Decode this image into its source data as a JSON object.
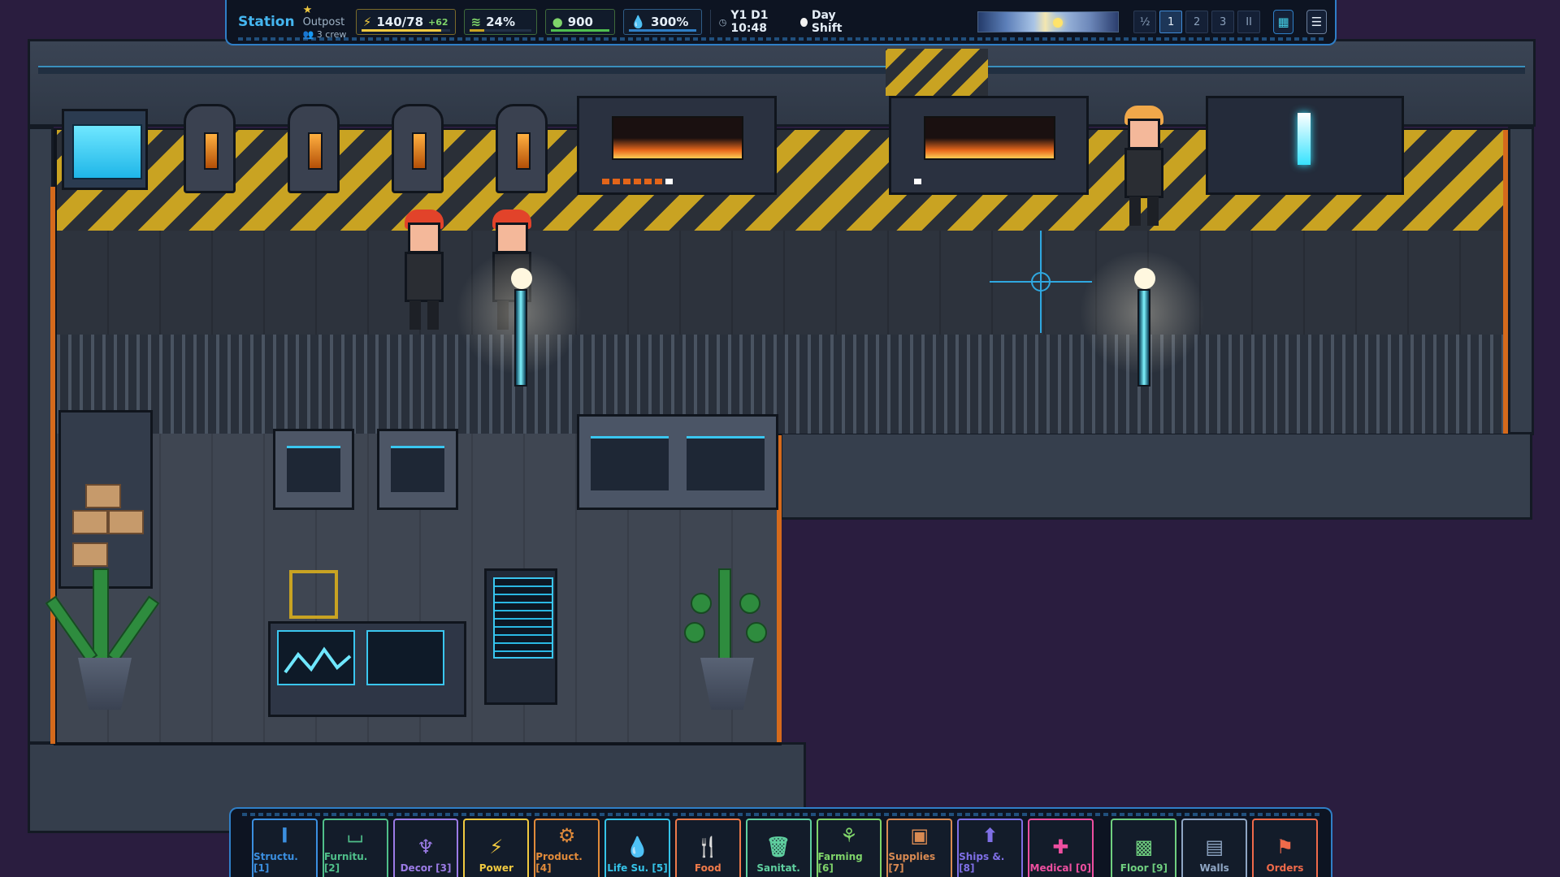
{
  "hud": {
    "title": "Station",
    "tier": "Outpost",
    "crew": "3 crew",
    "power_value": "140/78",
    "power_delta": "+62",
    "air_value": "24%",
    "food_value": "900",
    "water_value": "300%",
    "clock": "Y1 D1 10:48",
    "shift": "Day Shift",
    "speeds": [
      "½",
      "1",
      "2",
      "3",
      "II"
    ],
    "active_speed": "1"
  },
  "resource_levels": {
    "power": 0.9,
    "air": 0.24,
    "food": 1.0,
    "water": 1.0
  },
  "toolbar": {
    "tabs": [
      {
        "label": "Structu. [1]",
        "icon": "structure-icon",
        "color": "#3b8fe0"
      },
      {
        "label": "Furnitu. [2]",
        "icon": "furniture-icon",
        "color": "#4fbf8a"
      },
      {
        "label": "Decor [3]",
        "icon": "decor-icon",
        "color": "#9b7be6"
      },
      {
        "label": "Power",
        "icon": "lightning-icon",
        "color": "#f0c940"
      },
      {
        "label": "Product. [4]",
        "icon": "gear-icon",
        "color": "#e08a3a"
      },
      {
        "label": "Life Su. [5]",
        "icon": "droplet-icon",
        "color": "#35c3e8"
      },
      {
        "label": "Food",
        "icon": "utensils-icon",
        "color": "#ef7a4a"
      },
      {
        "label": "Sanitat.",
        "icon": "trash-icon",
        "color": "#5fcf9f"
      },
      {
        "label": "Farming [6]",
        "icon": "sprout-icon",
        "color": "#7fd46a"
      },
      {
        "label": "Supplies [7]",
        "icon": "crate-icon",
        "color": "#d98a52"
      },
      {
        "label": "Ships &. [8]",
        "icon": "ship-icon",
        "color": "#7f6fe6"
      },
      {
        "label": "Medical [0]",
        "icon": "medical-cross-icon",
        "color": "#ee4fa0"
      },
      {
        "label": "Floor [9]",
        "icon": "floor-icon",
        "color": "#6fcf7f"
      },
      {
        "label": "Walls",
        "icon": "wall-icon",
        "color": "#8fa6c4"
      },
      {
        "label": "Orders",
        "icon": "orders-icon",
        "color": "#ef6a4a"
      }
    ]
  },
  "colors": {
    "accent": "#2f7fc7",
    "hazard": "#c9a322",
    "hull_edge": "#d56a1c"
  }
}
